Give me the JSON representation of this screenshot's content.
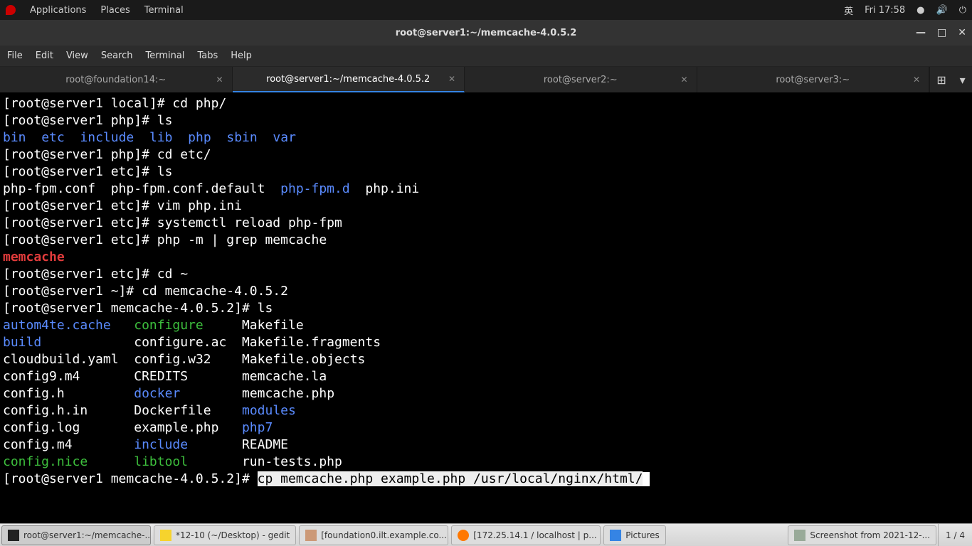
{
  "topbar": {
    "apps": "Applications",
    "places": "Places",
    "terminal": "Terminal",
    "ime": "英",
    "clock": "Fri 17:58"
  },
  "window": {
    "title": "root@server1:~/memcache-4.0.5.2",
    "menu": [
      "File",
      "Edit",
      "View",
      "Search",
      "Terminal",
      "Tabs",
      "Help"
    ],
    "tabs": [
      {
        "label": "root@foundation14:~",
        "active": false
      },
      {
        "label": "root@server1:~/memcache-4.0.5.2",
        "active": true
      },
      {
        "label": "root@server2:~",
        "active": false
      },
      {
        "label": "root@server3:~",
        "active": false
      }
    ]
  },
  "term": {
    "l1p": "[root@server1 local]# ",
    "l1c": "cd php/",
    "l2p": "[root@server1 php]# ",
    "l2c": "ls",
    "dirs1": [
      "bin",
      "etc",
      "include",
      "lib",
      "php",
      "sbin",
      "var"
    ],
    "l4p": "[root@server1 php]# ",
    "l4c": "cd etc/",
    "l5p": "[root@server1 etc]# ",
    "l5c": "ls",
    "f1": "php-fpm.conf  php-fpm.conf.default  ",
    "f1d": "php-fpm.d",
    "f1e": "  php.ini",
    "l7p": "[root@server1 etc]# ",
    "l7c": "vim php.ini",
    "l8p": "[root@server1 etc]# ",
    "l8c": "systemctl reload php-fpm",
    "l9p": "[root@server1 etc]# ",
    "l9c": "php -m | grep memcache",
    "mem": "memcache",
    "l11p": "[root@server1 etc]# ",
    "l11c": "cd ~",
    "l12p": "[root@server1 ~]# ",
    "l12c": "cd memcache-4.0.5.2",
    "l13p": "[root@server1 memcache-4.0.5.2]# ",
    "l13c": "ls",
    "r1a": "autom4te.cache",
    "r1b": "configure",
    "r1c": "Makefile",
    "r2a": "build",
    "r2b": "configure.ac",
    "r2c": "Makefile.fragments",
    "r3a": "cloudbuild.yaml",
    "r3b": "config.w32",
    "r3c": "Makefile.objects",
    "r4a": "config9.m4",
    "r4b": "CREDITS",
    "r4c": "memcache.la",
    "r5a": "config.h",
    "r5b": "docker",
    "r5c": "memcache.php",
    "r6a": "config.h.in",
    "r6b": "Dockerfile",
    "r6c": "modules",
    "r7a": "config.log",
    "r7b": "example.php",
    "r7c": "php7",
    "r8a": "config.m4",
    "r8b": "include",
    "r8c": "README",
    "r9a": "config.nice",
    "r9b": "libtool",
    "r9c": "run-tests.php",
    "lastp": "[root@server1 memcache-4.0.5.2]# ",
    "lastsel": "cp memcache.php example.php /usr/local/nginx/html/"
  },
  "taskbar": {
    "items": [
      {
        "label": "root@server1:~/memcache-...",
        "icon": "term"
      },
      {
        "label": "*12-10 (~/Desktop) - gedit",
        "icon": "gedit"
      },
      {
        "label": "[foundation0.ilt.example.co...",
        "icon": "vm"
      },
      {
        "label": "[172.25.14.1 / localhost | p...",
        "icon": "ff"
      },
      {
        "label": "Pictures",
        "icon": "folder"
      },
      {
        "label": "Screenshot from 2021-12-...",
        "icon": "img"
      }
    ],
    "ws": "1 / 4"
  }
}
